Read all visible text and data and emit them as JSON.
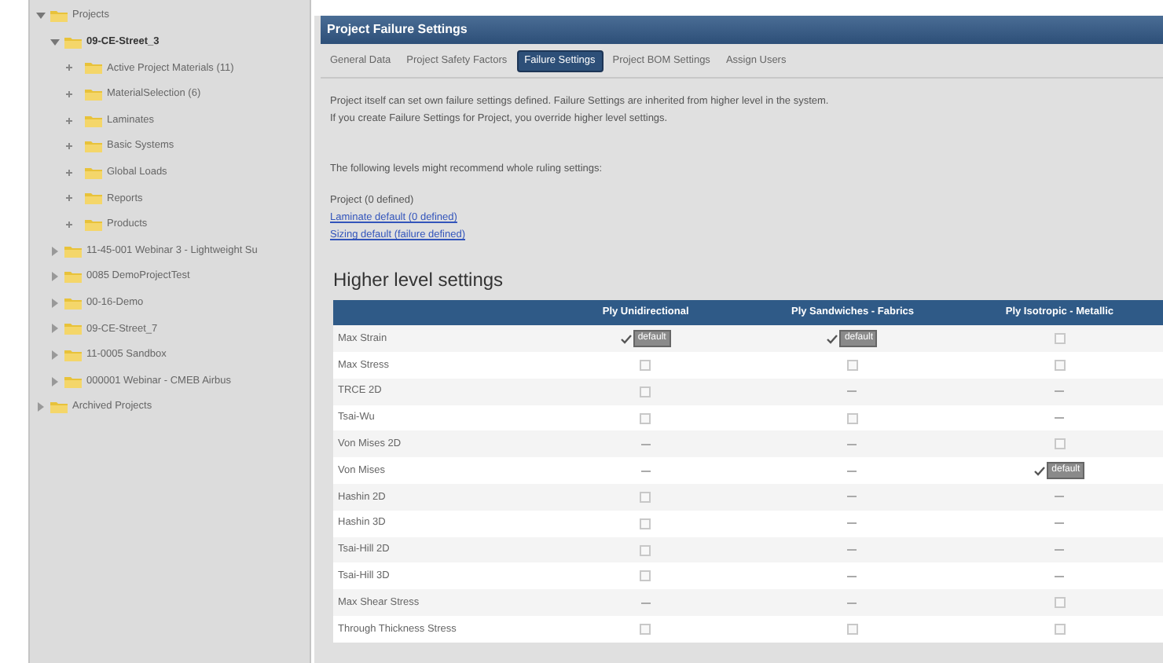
{
  "tree": [
    {
      "label": "Projects",
      "expanded": true,
      "children": [
        {
          "label": "09-CE-Street_3",
          "expanded": true,
          "selected": true,
          "children": [
            {
              "label": "Active Project Materials (11)",
              "expanded": false
            },
            {
              "label": "MaterialSelection (6)",
              "expanded": false
            },
            {
              "label": "Laminates",
              "expanded": false
            },
            {
              "label": "Basic Systems",
              "expanded": false
            },
            {
              "label": "Global Loads",
              "expanded": false
            },
            {
              "label": "Reports",
              "expanded": false
            },
            {
              "label": "Products",
              "expanded": false
            }
          ]
        },
        {
          "label": "11-45-001 Webinar 3 - Lightweight Su",
          "expanded": false,
          "selected": false
        },
        {
          "label": "0085 DemoProjectTest",
          "expanded": false,
          "selected": false
        },
        {
          "label": "00-16-Demo",
          "expanded": false,
          "selected": false
        },
        {
          "label": "09-CE-Street_7",
          "expanded": false,
          "selected": false
        },
        {
          "label": "11-0005 Sandbox",
          "expanded": false,
          "selected": false
        },
        {
          "label": "000001 Webinar - CMEB Airbus",
          "expanded": false,
          "selected": false
        }
      ]
    },
    {
      "label": "Archived Projects",
      "expanded": false
    }
  ],
  "panel": {
    "title": "Project Failure Settings",
    "tabs": [
      {
        "label": "General Data",
        "selected": false
      },
      {
        "label": "Project Safety Factors",
        "selected": false
      },
      {
        "label": "Failure Settings",
        "selected": true
      },
      {
        "label": "Project BOM Settings",
        "selected": false
      },
      {
        "label": "Assign Users",
        "selected": false
      }
    ],
    "intro": [
      "Project itself can set own failure settings defined. Failure Settings are inherited from higher level in the system.",
      "If you create Failure Settings for Project, you override higher level settings."
    ],
    "levels_heading": "The following levels might recommend whole ruling settings:",
    "levels": [
      {
        "label": "Project (0 defined)",
        "kind": "text"
      },
      {
        "label": "Laminate default (0 defined)",
        "kind": "link"
      },
      {
        "label": "Sizing default (failure defined)",
        "kind": "link"
      }
    ],
    "section_title": "Higher level settings",
    "table": {
      "columns": [
        "Ply Unidirectional",
        "Ply Sandwiches - Fabrics",
        "Ply Isotropic - Metallic"
      ],
      "rows": [
        {
          "label": "Max Strain",
          "cells": [
            {
              "kind": "default",
              "badge": "default"
            },
            {
              "kind": "default",
              "badge": "default"
            },
            {
              "kind": "checkbox",
              "checked": false
            }
          ]
        },
        {
          "label": "Max Stress",
          "cells": [
            {
              "kind": "checkbox",
              "checked": false
            },
            {
              "kind": "checkbox",
              "checked": false
            },
            {
              "kind": "checkbox",
              "checked": false
            }
          ]
        },
        {
          "label": "TRCE 2D",
          "cells": [
            {
              "kind": "checkbox",
              "checked": false
            },
            {
              "kind": "dash"
            },
            {
              "kind": "dash"
            }
          ]
        },
        {
          "label": "Tsai-Wu",
          "cells": [
            {
              "kind": "checkbox",
              "checked": false
            },
            {
              "kind": "checkbox",
              "checked": false
            },
            {
              "kind": "dash"
            }
          ]
        },
        {
          "label": "Von Mises 2D",
          "cells": [
            {
              "kind": "dash"
            },
            {
              "kind": "dash"
            },
            {
              "kind": "checkbox",
              "checked": false
            }
          ]
        },
        {
          "label": "Von Mises",
          "cells": [
            {
              "kind": "dash"
            },
            {
              "kind": "dash"
            },
            {
              "kind": "default",
              "badge": "default"
            }
          ]
        },
        {
          "label": "Hashin 2D",
          "cells": [
            {
              "kind": "checkbox",
              "checked": false
            },
            {
              "kind": "dash"
            },
            {
              "kind": "dash"
            }
          ]
        },
        {
          "label": "Hashin 3D",
          "cells": [
            {
              "kind": "checkbox",
              "checked": false
            },
            {
              "kind": "dash"
            },
            {
              "kind": "dash"
            }
          ]
        },
        {
          "label": "Tsai-Hill 2D",
          "cells": [
            {
              "kind": "checkbox",
              "checked": false
            },
            {
              "kind": "dash"
            },
            {
              "kind": "dash"
            }
          ]
        },
        {
          "label": "Tsai-Hill 3D",
          "cells": [
            {
              "kind": "checkbox",
              "checked": false
            },
            {
              "kind": "dash"
            },
            {
              "kind": "dash"
            }
          ]
        },
        {
          "label": "Max Shear Stress",
          "cells": [
            {
              "kind": "dash"
            },
            {
              "kind": "dash"
            },
            {
              "kind": "checkbox",
              "checked": false
            }
          ]
        },
        {
          "label": "Through Thickness Stress",
          "cells": [
            {
              "kind": "checkbox",
              "checked": false
            },
            {
              "kind": "checkbox",
              "checked": false
            },
            {
              "kind": "checkbox",
              "checked": false
            }
          ]
        }
      ]
    }
  }
}
